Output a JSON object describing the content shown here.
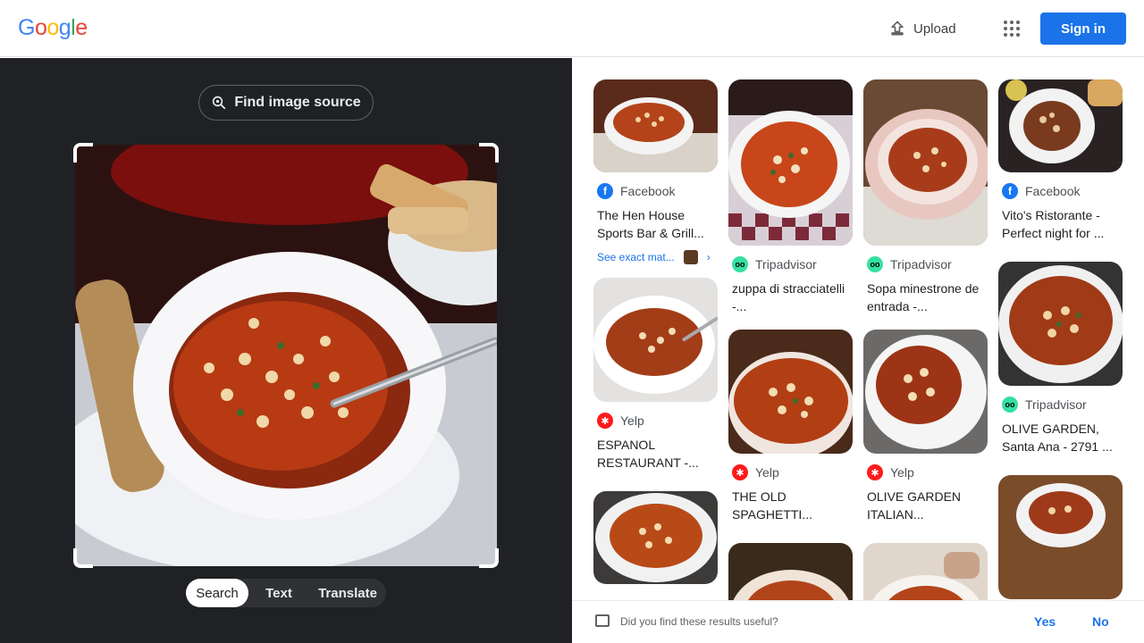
{
  "header": {
    "logo_text": "Google",
    "upload_label": "Upload",
    "apps_icon": "apps-grid-icon",
    "signin_label": "Sign in"
  },
  "left_panel": {
    "find_source_label": "Find image source",
    "query_image": "bowl of minestrone soup with spoon and bread",
    "modes": [
      "Search",
      "Text",
      "Translate"
    ],
    "active_mode": "Search"
  },
  "results": {
    "columns": [
      [
        {
          "image": "soup-bowl",
          "source": "Facebook",
          "title": "The Hen House Sports Bar & Grill...",
          "exact_match": "See exact mat..."
        },
        {
          "image": "soup-bowl",
          "source": "Yelp",
          "title": "ESPANOL RESTAURANT -..."
        },
        {
          "image": "soup-bowl"
        }
      ],
      [
        {
          "image": "soup-bowl",
          "source": "Tripadvisor",
          "title": "zuppa di stracciatelli -..."
        },
        {
          "image": "soup-bowl",
          "source": "Yelp",
          "title": "THE OLD SPAGHETTI..."
        },
        {
          "image": "soup-bowl"
        }
      ],
      [
        {
          "image": "soup-bowl",
          "source": "Tripadvisor",
          "title": "Sopa minestrone de entrada -..."
        },
        {
          "image": "soup-bowl",
          "source": "Yelp",
          "title": "OLIVE GARDEN ITALIAN..."
        },
        {
          "image": "soup-bowl"
        }
      ],
      [
        {
          "image": "soup-bowl",
          "source": "Facebook",
          "title": "Vito's Ristorante - Perfect night for ..."
        },
        {
          "image": "soup-bowl",
          "source": "Tripadvisor",
          "title": "OLIVE GARDEN, Santa Ana - 2791 ..."
        },
        {
          "image": "soup-bowl"
        }
      ]
    ]
  },
  "feedback": {
    "question": "Did you find these results useful?",
    "yes": "Yes",
    "no": "No"
  }
}
